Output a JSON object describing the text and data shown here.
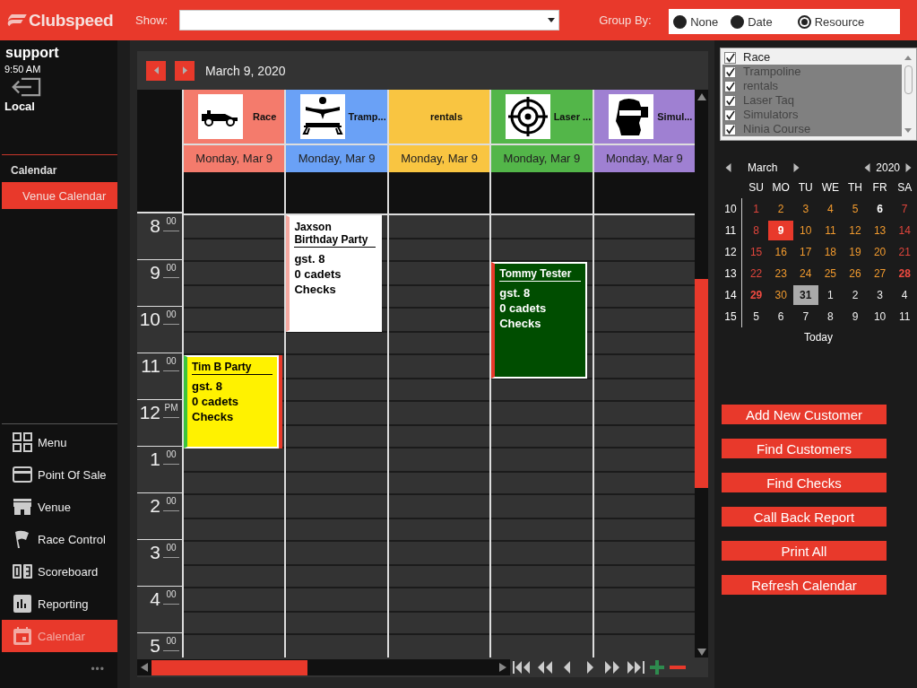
{
  "brand": {
    "name": "Clubspeed"
  },
  "toolbar": {
    "show_label": "Show:",
    "group_label": "Group By:",
    "group_options": [
      {
        "label": "None",
        "selected": false
      },
      {
        "label": "Date",
        "selected": false
      },
      {
        "label": "Resource",
        "selected": true
      }
    ]
  },
  "user": {
    "name": "support",
    "time": "9:50 AM",
    "location": "Local"
  },
  "section": {
    "title": "Calendar",
    "items": [
      {
        "label": "Venue Calendar",
        "selected": true
      }
    ]
  },
  "nav": [
    {
      "label": "Menu",
      "kind": "grid",
      "selected": false
    },
    {
      "label": "Point Of Sale",
      "kind": "card",
      "selected": false
    },
    {
      "label": "Venue",
      "kind": "store",
      "selected": false
    },
    {
      "label": "Race Control",
      "kind": "flag",
      "selected": false
    },
    {
      "label": "Scoreboard",
      "kind": "score",
      "selected": false
    },
    {
      "label": "Reporting",
      "kind": "chart",
      "selected": false
    },
    {
      "label": "Calendar",
      "kind": "calendar",
      "selected": true
    }
  ],
  "more": "•••",
  "calendar": {
    "date": "March 9, 2020",
    "columns": [
      {
        "name": "Race",
        "kind": "car",
        "color": "#f47b6c",
        "date": "Monday, Mar 9",
        "events": [
          {
            "title": "Tim B Party",
            "lines": [
              "gst. 8",
              "0 cadets",
              "Checks"
            ],
            "color": "#fff200"
          }
        ]
      },
      {
        "name": "Tramp...",
        "kind": "trampoline",
        "color": "#6aa1f6",
        "date": "Monday, Mar 9",
        "events": [
          {
            "title": "Jaxson Birthday Party",
            "lines": [
              "gst. 8",
              "0 cadets",
              "Checks"
            ],
            "color": "#ffffff"
          }
        ]
      },
      {
        "name": "rentals",
        "kind": "plain",
        "color": "#f9c541",
        "date": "Monday, Mar 9"
      },
      {
        "name": "Laser ...",
        "kind": "target",
        "color": "#53b649",
        "date": "Monday, Mar 9",
        "events": [
          {
            "title": "Tommy Tester",
            "lines": [
              "gst. 8",
              "0 cadets",
              "Checks"
            ],
            "color": "#004d00"
          }
        ]
      },
      {
        "name": "Simul...",
        "kind": "headset",
        "color": "#9f80d2",
        "date": "Monday, Mar 9"
      }
    ],
    "hours": [
      {
        "hour": "8",
        "suffix": "00"
      },
      {
        "hour": "9",
        "suffix": "00"
      },
      {
        "hour": "10",
        "suffix": "00"
      },
      {
        "hour": "11",
        "suffix": "00"
      },
      {
        "hour": "12",
        "suffix": "PM"
      },
      {
        "hour": "1",
        "suffix": "00"
      },
      {
        "hour": "2",
        "suffix": "00"
      },
      {
        "hour": "3",
        "suffix": "00"
      },
      {
        "hour": "4",
        "suffix": "00"
      },
      {
        "hour": "5",
        "suffix": "00"
      }
    ]
  },
  "resources": [
    {
      "label": "Race",
      "checked": true,
      "selected": true
    },
    {
      "label": "Trampoline",
      "checked": true,
      "selected": false
    },
    {
      "label": "rentals",
      "checked": true,
      "selected": false
    },
    {
      "label": "Laser Taq",
      "checked": true,
      "selected": false
    },
    {
      "label": "Simulators",
      "checked": true,
      "selected": false
    },
    {
      "label": "Ninia Course",
      "checked": true,
      "selected": false
    }
  ],
  "mini_calendar": {
    "month": "March",
    "year": "2020",
    "weekdays": [
      "SU",
      "MO",
      "TU",
      "WE",
      "TH",
      "FR",
      "SA"
    ],
    "weeks": [
      {
        "number": "10",
        "days": [
          {
            "d": "1",
            "kind": "weekend",
            "selected": false
          },
          {
            "d": "2",
            "kind": "weekday",
            "selected": false
          },
          {
            "d": "3",
            "kind": "weekday",
            "selected": false
          },
          {
            "d": "4",
            "kind": "weekday",
            "selected": false
          },
          {
            "d": "5",
            "kind": "weekday",
            "selected": false
          },
          {
            "d": "6",
            "kind": "marked",
            "selected": false
          },
          {
            "d": "7",
            "kind": "weekend",
            "selected": false
          }
        ]
      },
      {
        "number": "11",
        "days": [
          {
            "d": "8",
            "kind": "weekend",
            "selected": false
          },
          {
            "d": "9",
            "kind": "weekday",
            "selected": true
          },
          {
            "d": "10",
            "kind": "weekday",
            "selected": false
          },
          {
            "d": "11",
            "kind": "weekday",
            "selected": false
          },
          {
            "d": "12",
            "kind": "weekday",
            "selected": false
          },
          {
            "d": "13",
            "kind": "weekday",
            "selected": false
          },
          {
            "d": "14",
            "kind": "weekend",
            "selected": false
          }
        ]
      },
      {
        "number": "12",
        "days": [
          {
            "d": "15",
            "kind": "weekend",
            "selected": false
          },
          {
            "d": "16",
            "kind": "weekday",
            "selected": false
          },
          {
            "d": "17",
            "kind": "weekday",
            "selected": false
          },
          {
            "d": "18",
            "kind": "weekday",
            "selected": false
          },
          {
            "d": "19",
            "kind": "weekday",
            "selected": false
          },
          {
            "d": "20",
            "kind": "weekday",
            "selected": false
          },
          {
            "d": "21",
            "kind": "weekend",
            "selected": false
          }
        ]
      },
      {
        "number": "13",
        "days": [
          {
            "d": "22",
            "kind": "weekend",
            "selected": false
          },
          {
            "d": "23",
            "kind": "weekday",
            "selected": false
          },
          {
            "d": "24",
            "kind": "weekday",
            "selected": false
          },
          {
            "d": "25",
            "kind": "weekday",
            "selected": false
          },
          {
            "d": "26",
            "kind": "weekday",
            "selected": false
          },
          {
            "d": "27",
            "kind": "weekday",
            "selected": false
          },
          {
            "d": "28",
            "kind": "weekend_marked",
            "selected": false
          }
        ]
      },
      {
        "number": "14",
        "days": [
          {
            "d": "29",
            "kind": "weekend_marked",
            "selected": false
          },
          {
            "d": "30",
            "kind": "weekday",
            "selected": false
          },
          {
            "d": "31",
            "kind": "today",
            "selected": false
          },
          {
            "d": "1",
            "kind": "other",
            "selected": false
          },
          {
            "d": "2",
            "kind": "other",
            "selected": false
          },
          {
            "d": "3",
            "kind": "other",
            "selected": false
          },
          {
            "d": "4",
            "kind": "other",
            "selected": false
          }
        ]
      },
      {
        "number": "15",
        "days": [
          {
            "d": "5",
            "kind": "other",
            "selected": false
          },
          {
            "d": "6",
            "kind": "other",
            "selected": false
          },
          {
            "d": "7",
            "kind": "other",
            "selected": false
          },
          {
            "d": "8",
            "kind": "other",
            "selected": false
          },
          {
            "d": "9",
            "kind": "other",
            "selected": false
          },
          {
            "d": "10",
            "kind": "other",
            "selected": false
          },
          {
            "d": "11",
            "kind": "other",
            "selected": false
          }
        ]
      }
    ],
    "today_label": "Today"
  },
  "actions": [
    "Add New Customer",
    "Find Customers",
    "Find Checks",
    "Call Back Report",
    "Print All",
    "Refresh Calendar"
  ]
}
